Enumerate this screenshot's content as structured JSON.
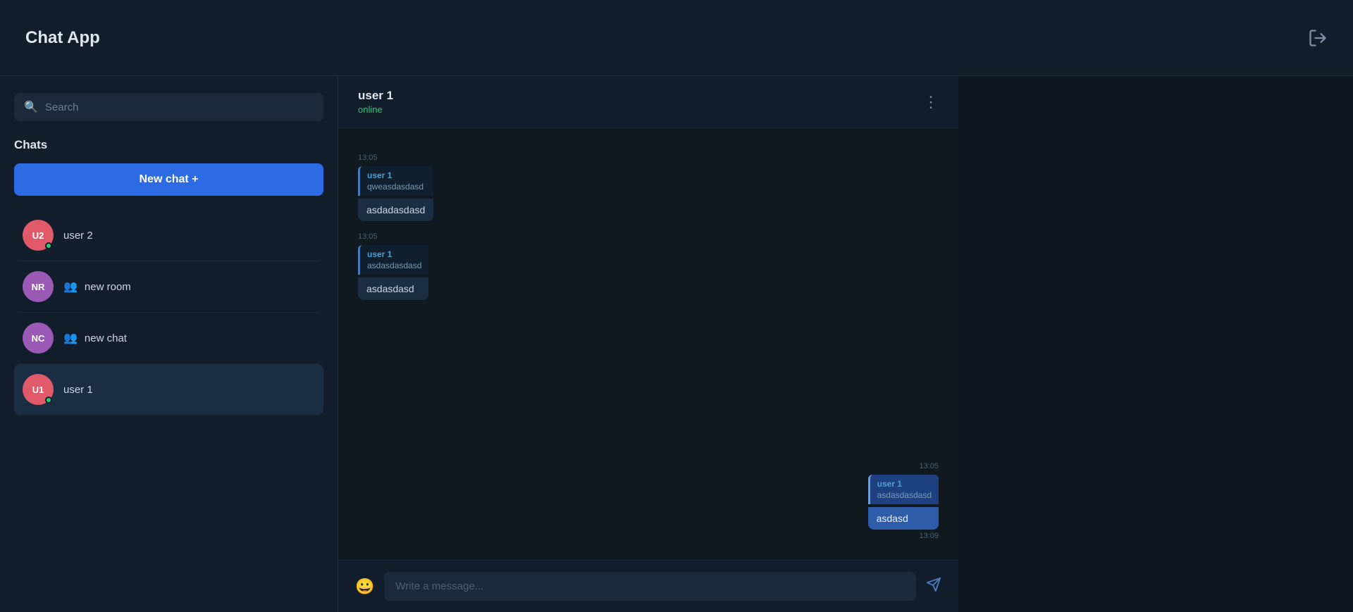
{
  "header": {
    "title": "Chat App",
    "logout_label": "logout"
  },
  "sidebar": {
    "search_placeholder": "Search",
    "chats_label": "Chats",
    "new_chat_btn": "New chat +",
    "items": [
      {
        "id": "user2",
        "avatar": "U2",
        "name": "user 2",
        "type": "direct",
        "online": true,
        "active": false
      },
      {
        "id": "newroom",
        "avatar": "NR",
        "name": "new room",
        "type": "group",
        "online": false,
        "active": false
      },
      {
        "id": "newchat",
        "avatar": "NC",
        "name": "new chat",
        "type": "group",
        "online": false,
        "active": false
      },
      {
        "id": "user1",
        "avatar": "U1",
        "name": "user 1",
        "type": "direct",
        "online": true,
        "active": true
      }
    ]
  },
  "chat": {
    "header_name": "user 1",
    "header_status": "online",
    "messages": [
      {
        "id": "m1",
        "timestamp": "13:05",
        "direction": "incoming",
        "quoted_user": "user 1",
        "quoted_text": "qweasdasdasd",
        "text": "asdadasdasd"
      },
      {
        "id": "m2",
        "timestamp": "13:05",
        "direction": "incoming",
        "quoted_user": "user 1",
        "quoted_text": "asdasdasdasd",
        "text": "asdasdasd"
      },
      {
        "id": "m3",
        "timestamp": "13:05",
        "direction": "outgoing",
        "quoted_user": "user 1",
        "quoted_text": "asdasdasdasd",
        "text": "asdasd",
        "time_below": "13:09"
      }
    ],
    "input_placeholder": "Write a message..."
  }
}
